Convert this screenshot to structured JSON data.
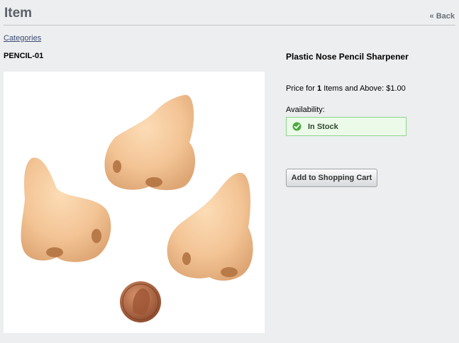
{
  "header": {
    "title": "Item",
    "back_label": "« Back"
  },
  "breadcrumb": {
    "categories_label": "Categories"
  },
  "product": {
    "sku": "PENCIL-01",
    "name": "Plastic Nose Pencil Sharpener",
    "price_prefix": "Price for ",
    "price_qty": "1",
    "price_suffix": " Items and Above: $1.00",
    "availability_label": "Availability:",
    "stock_status": "In Stock",
    "stock_icon": "check-circle-icon"
  },
  "actions": {
    "add_to_cart_label": "Add to Shopping Cart"
  },
  "colors": {
    "page_bg": "#eceef0",
    "stock_bg": "#ecfaea",
    "stock_border": "#8fd48a",
    "stock_check": "#4caa3d"
  }
}
